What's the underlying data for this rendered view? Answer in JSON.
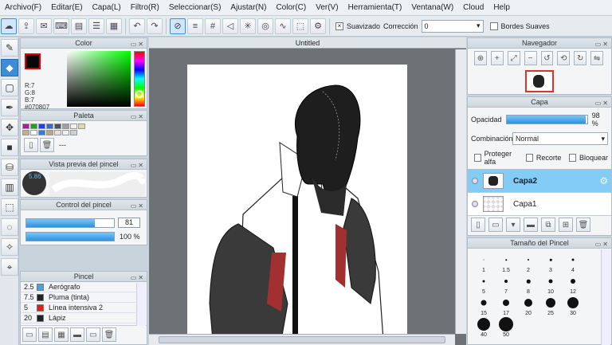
{
  "menu": [
    "Archivo(F)",
    "Editar(E)",
    "Capa(L)",
    "Filtro(R)",
    "Seleccionar(S)",
    "Ajustar(N)",
    "Color(C)",
    "Ver(V)",
    "Herramienta(T)",
    "Ventana(W)",
    "Cloud",
    "Help"
  ],
  "toolbar": {
    "bordes_label": "Bordes Suaves",
    "suavizado_label": "Suavizado",
    "correccion_label": "Corrección",
    "correccion_value": "0",
    "checkmark": "×"
  },
  "color_panel": {
    "title": "Color",
    "r": "R:7",
    "g": "G:8",
    "b": "B:7",
    "hex": "#070807",
    "fg_color": "#070807",
    "bg_color": "#ffffff"
  },
  "palette_panel": {
    "title": "Paleta",
    "dash": "---",
    "colors": [
      "#a020a0",
      "#20a020",
      "#2040e0",
      "#3070c0",
      "#505060",
      "#a0a0a0",
      "#f0f0e8",
      "#e0d8b0",
      "#c0b090",
      "#ffffff",
      "#2f7fd8",
      "#c0a088",
      "#e8e0d8",
      "#f0f0f0",
      "#d0d0d0"
    ]
  },
  "brush_preview": {
    "title": "Vista previa del pincel",
    "size": "5.86"
  },
  "brush_control": {
    "title": "Control del pincel",
    "size": "81",
    "opacity": "100 %",
    "size_fraction": 0.78,
    "opacity_fraction": 1.0
  },
  "pincel_panel": {
    "title": "Pincel",
    "items": [
      {
        "num": "2.5",
        "name": "Aerógrafo",
        "color": "#4aa3df"
      },
      {
        "num": "7.5",
        "name": "Pluma (tinta)",
        "color": "#222222"
      },
      {
        "num": "5",
        "name": "Línea intensiva 2",
        "color": "#e02020"
      },
      {
        "num": "20",
        "name": "Lápiz",
        "color": "#222222"
      }
    ]
  },
  "document": {
    "tab": "Untitled"
  },
  "navigator": {
    "title": "Navegador"
  },
  "layer_panel": {
    "title": "Capa",
    "opacity_label": "Opacidad",
    "opacity_value": "98 %",
    "opacity_fraction": 0.98,
    "blend_label": "Combinación",
    "blend_value": "Normal",
    "protect_alpha": "Proteger alfa",
    "clip": "Recorte",
    "lock": "Bloquear",
    "layers": [
      {
        "name": "Capa2",
        "selected": true
      },
      {
        "name": "Capa1",
        "selected": false
      }
    ]
  },
  "brush_size_panel": {
    "title": "Tamaño del Pincel",
    "sizes": [
      "1",
      "1.5",
      "2",
      "3",
      "4",
      "5",
      "7",
      "8",
      "10",
      "12",
      "15",
      "17",
      "20",
      "25",
      "30",
      "40",
      "50"
    ],
    "extra_sizes": [
      "20",
      "25",
      "30",
      "40",
      "50"
    ]
  }
}
